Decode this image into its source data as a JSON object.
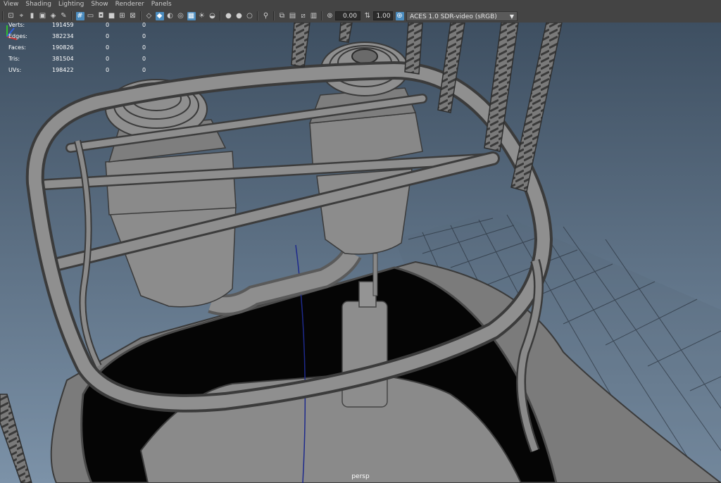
{
  "menubar": {
    "items": [
      "View",
      "Shading",
      "Lighting",
      "Show",
      "Renderer",
      "Panels"
    ]
  },
  "toolbar": {
    "exposure": "0.00",
    "gamma": "1.00",
    "color_transform": "ACES 1.0 SDR-video (sRGB)",
    "icons": [
      "camera-select-icon",
      "camera-attributes-icon",
      "bookmark-icon",
      "image-plane-icon",
      "isolate-icon",
      "xray-icon",
      "grid-icon",
      "film-gate-icon",
      "resolution-gate-icon",
      "gate-mask-icon",
      "field-chart-icon",
      "safe-action-icon",
      "wireframe-icon",
      "smooth-shade-icon",
      "default-material-icon",
      "textured-icon",
      "lights-icon",
      "shadows-icon",
      "ambient-occlusion-icon",
      "motion-blur-icon",
      "anti-alias-icon",
      "depth-of-field-icon",
      "isolate-select-icon",
      "xray-joints-icon",
      "xray-active-icon",
      "backface-icon",
      "exposure-icon",
      "gamma-icon",
      "color-management-icon"
    ]
  },
  "hud": {
    "rows": [
      {
        "label": "Verts:",
        "v1": "191459",
        "v2": "0",
        "v3": "0"
      },
      {
        "label": "Edges:",
        "v1": "382234",
        "v2": "0",
        "v3": "0"
      },
      {
        "label": "Faces:",
        "v1": "190826",
        "v2": "0",
        "v3": "0"
      },
      {
        "label": "Tris:",
        "v1": "381504",
        "v2": "0",
        "v3": "0"
      },
      {
        "label": "UVs:",
        "v1": "198422",
        "v2": "0",
        "v3": "0"
      }
    ]
  },
  "viewport": {
    "camera": "persp",
    "colors": {
      "sky_top": "#3f5063",
      "sky_bottom": "#7f95ab",
      "mesh": "#8a8a8a",
      "mesh_dark": "#5e5e5e",
      "grid": "#2a3038"
    }
  }
}
